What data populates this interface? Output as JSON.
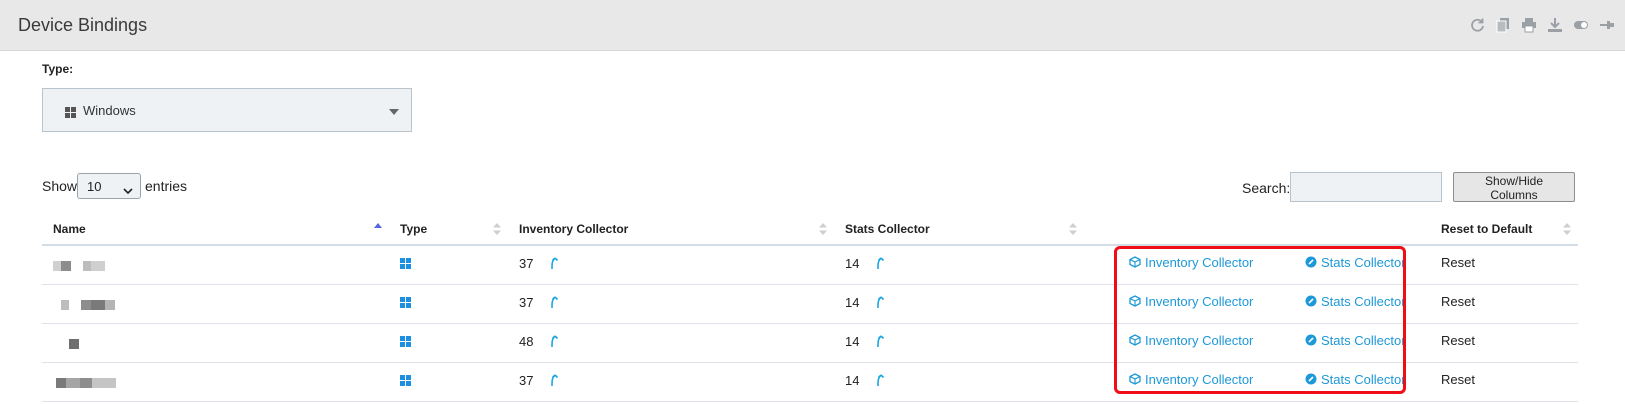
{
  "header": {
    "title": "Device Bindings",
    "tools": [
      "refresh-icon",
      "copy-icon",
      "print-icon",
      "download-icon",
      "toggle-icon",
      "pin-icon"
    ]
  },
  "filter": {
    "type_label": "Type:",
    "type_value": "Windows"
  },
  "table_controls": {
    "show_label": "Show",
    "entries_value": "10",
    "entries_label": "entries",
    "search_label": "Search:",
    "search_value": "",
    "show_hide_label": "Show/Hide Columns"
  },
  "table": {
    "columns": [
      "Name",
      "Type",
      "Inventory Collector",
      "Stats Collector",
      "",
      "Reset to Default"
    ],
    "sorted_column": "Name",
    "rows": [
      {
        "inventory_count": "37",
        "stats_count": "14",
        "inventory_link": "Inventory Collector",
        "stats_link": "Stats Collector",
        "reset": "Reset"
      },
      {
        "inventory_count": "37",
        "stats_count": "14",
        "inventory_link": "Inventory Collector",
        "stats_link": "Stats Collector",
        "reset": "Reset"
      },
      {
        "inventory_count": "48",
        "stats_count": "14",
        "inventory_link": "Inventory Collector",
        "stats_link": "Stats Collector",
        "reset": "Reset"
      },
      {
        "inventory_count": "37",
        "stats_count": "14",
        "inventory_link": "Inventory Collector",
        "stats_link": "Stats Collector",
        "reset": "Reset"
      }
    ]
  },
  "colors": {
    "link": "#1d98d8",
    "highlight_border": "#ef0e16",
    "header_bg": "#e8e8e8",
    "windows_icon": "#1d8fe0"
  }
}
